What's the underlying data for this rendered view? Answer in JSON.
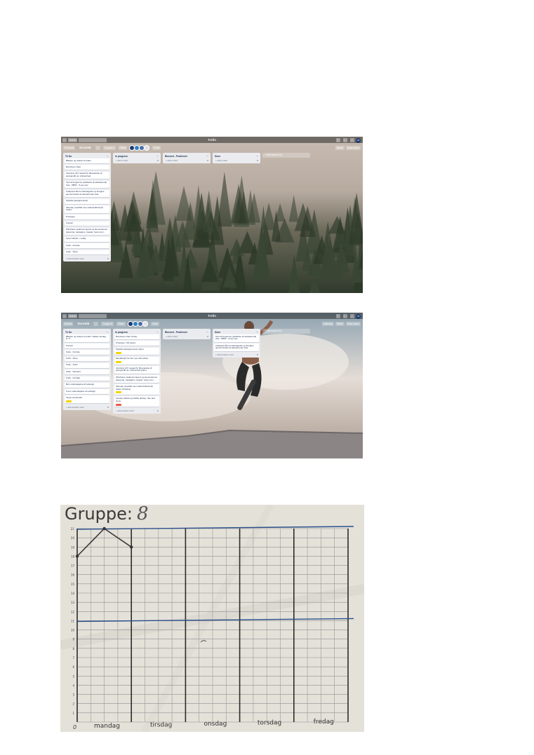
{
  "shot1": {
    "app_title": "Trello",
    "boards_label": "Boards",
    "board_name": "Scrumb",
    "team": "Gruppe 8",
    "visibility": "Public",
    "invite": "Invite",
    "butler": "Butler",
    "show_menu": "Show menu",
    "add_list": "+ Add another list",
    "lists": [
      {
        "title": "To Do",
        "cards": [
          {
            "text": "Billeder og videoer til siden"
          },
          {
            "text": "Burndown chart"
          },
          {
            "text": "Interview (UX research). Besvarelse af spørgsmål om virksomhed"
          },
          {
            "text": "Test af brugernes opfattelse af eksisterende side - 8BNT - 5-sec test"
          },
          {
            "text": "Analysere Bert undersøgelse og foregive gennemsnittet af eksisterende side"
          },
          {
            "text": "Styletile (designproces)"
          },
          {
            "text": "Sitemap (overblik over siden/indhold på siden)"
          },
          {
            "text": "Prototype"
          },
          {
            "text": "Fonsell"
          },
          {
            "text": "Wireframe (sidernes layout og elementernes placering: navigation, header, footer etc.)"
          },
          {
            "text": "Opret Github + netlify"
          },
          {
            "text": "Kode - Forside"
          },
          {
            "text": "Kode - Shop"
          }
        ],
        "add": "+ Add another card"
      },
      {
        "title": "In progress",
        "cards": [],
        "add": "+ Add a card"
      },
      {
        "title": "Blocked - Problemer",
        "cards": [],
        "add": "+ Add a card"
      },
      {
        "title": "Done",
        "cards": [],
        "add": "+ Add a card"
      }
    ]
  },
  "shot2": {
    "app_title": "Trello",
    "boards_label": "Boards",
    "board_name": "Scrumb",
    "team": "Gruppe 8",
    "visibility": "Public",
    "invite": "Invite",
    "calendar": "Calendar",
    "butler": "Butler",
    "show_menu": "Show menu",
    "add_list": "+ Add another list",
    "lists": [
      {
        "title": "To Do",
        "cards": [
          {
            "text": "Billeder og videoer til siden. Nadas mindag kl. 8"
          },
          {
            "text": "Fonsell"
          },
          {
            "text": "Kode - Forside"
          },
          {
            "text": "Kode - Shop"
          },
          {
            "text": "Kode - Team"
          },
          {
            "text": "Kode - Renders"
          },
          {
            "text": "Kode - Kontakt"
          },
          {
            "text": "Bert undersøgelse af redesign"
          },
          {
            "text": "5-sec undersøgelse af redesign"
          },
          {
            "text": "Tegne storyboard",
            "label": "yellow"
          }
        ],
        "add": "+ Add another card"
      },
      {
        "title": "In progress",
        "cards": [
          {
            "text": "Burndown chart (Ursa)"
          },
          {
            "text": "Prototype i XD (Alex)"
          },
          {
            "text": "Styletile (designproces) (Alex)",
            "label": "yellow"
          },
          {
            "text": "Moodboard for den nye side (Alex)",
            "label": "yellow"
          },
          {
            "text": "Interview (UX research). Besvarelse af spørgsmål om virksomhed (Alex)"
          },
          {
            "text": "Wireframe (sidernes layout og elementernes placering: navigation, header, footer etc.)"
          },
          {
            "text": "Sitemap (overblik over siden/indhold på siden) (Kristina)",
            "label": "yellow"
          },
          {
            "text": "Oprette Github og Netlify (Emily), Site and clone",
            "label": "red"
          }
        ],
        "add": "+ Add another card"
      },
      {
        "title": "Blocked - Problemer",
        "cards": [],
        "add": "+ Add a card"
      },
      {
        "title": "Done",
        "cards": [
          {
            "text": "Test af brugernes opfattelse af eksisterende side - 8BNT - 5-sec test"
          },
          {
            "text": "Analysere Bert undersøgelse og foregive gennemsnittet af eksisterende side"
          }
        ],
        "add": "+ Add another card"
      }
    ]
  },
  "burndown": {
    "title": "Gruppe:",
    "group_number": "8",
    "x_axis_origin": "0",
    "days": [
      "mandag",
      "tirsdag",
      "onsdag",
      "torsdag",
      "fredag"
    ],
    "y_ticks": [
      "1",
      "2",
      "3",
      "4",
      "5",
      "6",
      "7",
      "8",
      "9",
      "10",
      "11",
      "12",
      "13",
      "14",
      "15",
      "16",
      "17",
      "18",
      "19",
      "20",
      "21"
    ],
    "chart_data": {
      "type": "line",
      "title": "Gruppe: 8",
      "xlabel": "",
      "ylabel": "",
      "categories": [
        "mandag",
        "tirsdag",
        "onsdag",
        "torsdag",
        "fredag"
      ],
      "ylim": [
        0,
        21
      ],
      "series": [
        {
          "values_by_step": [
            {
              "x": 0,
              "y": 18
            },
            {
              "x": 0.5,
              "y": 21
            },
            {
              "x": 1,
              "y": 19
            }
          ]
        }
      ],
      "reference_lines": [
        21,
        11
      ]
    }
  }
}
